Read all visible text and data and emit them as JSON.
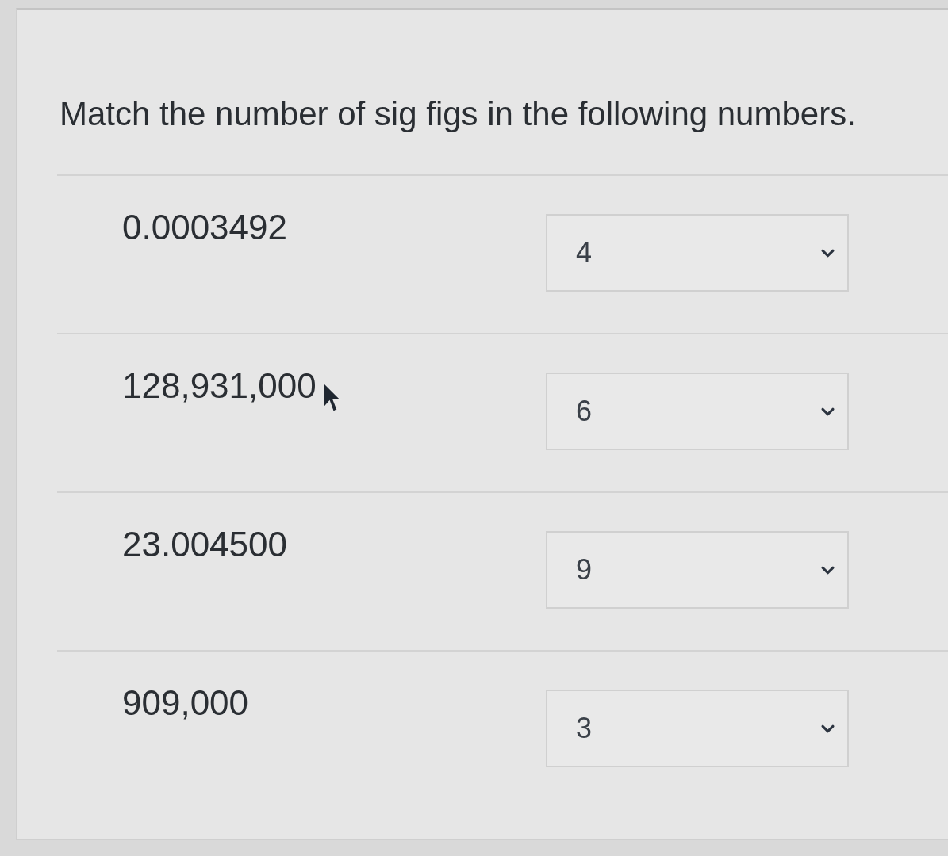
{
  "question": {
    "prompt": "Match the number of sig figs in the following numbers.",
    "items": [
      {
        "number": "0.0003492",
        "answer": "4"
      },
      {
        "number": "128,931,000",
        "answer": "6"
      },
      {
        "number": "23.004500",
        "answer": "9"
      },
      {
        "number": "909,000",
        "answer": "3"
      }
    ]
  }
}
